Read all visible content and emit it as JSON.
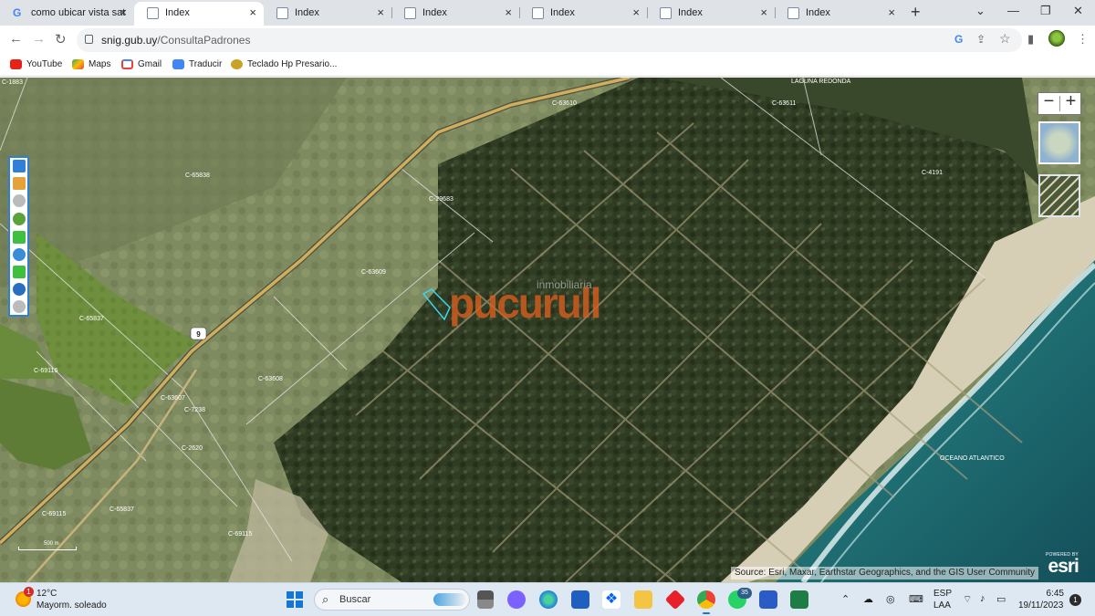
{
  "browser": {
    "tabs": [
      {
        "title": "como ubicar vista sat",
        "favicon": "google-icon",
        "active": false
      },
      {
        "title": "Index",
        "favicon": "page-icon",
        "active": true
      },
      {
        "title": "Index",
        "favicon": "page-icon",
        "active": false
      },
      {
        "title": "Index",
        "favicon": "page-icon",
        "active": false
      },
      {
        "title": "Index",
        "favicon": "page-icon",
        "active": false
      },
      {
        "title": "Index",
        "favicon": "page-icon",
        "active": false
      },
      {
        "title": "Index",
        "favicon": "page-icon",
        "active": false
      }
    ],
    "new_tab_symbol": "+",
    "url_host": "snig.gub.uy",
    "url_path": "/ConsultaPadrones",
    "bookmarks": [
      {
        "label": "YouTube",
        "icon": "youtube-icon",
        "color": "#e62117"
      },
      {
        "label": "Maps",
        "icon": "maps-icon",
        "color": "#34a853"
      },
      {
        "label": "Gmail",
        "icon": "gmail-icon",
        "color": "#ea4335"
      },
      {
        "label": "Traducir",
        "icon": "translate-icon",
        "color": "#4285f4"
      },
      {
        "label": "Teclado Hp Presario...",
        "icon": "keyboard-icon",
        "color": "#b8860b"
      }
    ]
  },
  "map": {
    "parcel_labels": [
      "C-1883",
      "C-63610",
      "C-63611",
      "LAGUNA REDONDA",
      "C-65838",
      "C-29683",
      "C-4191",
      "C-63609",
      "C-65837",
      "C-69116",
      "C-63608",
      "C-63607",
      "C-7238",
      "C-2620",
      "C-65837",
      "C-69115",
      "C-69115",
      "OCEANO ATLANTICO"
    ],
    "route_shield": "9",
    "watermark": "pucurull",
    "watermark_subtitle": "inmobiliaria",
    "scale_label": "500 m",
    "attribution": "Source: Esri, Maxar, Earthstar Geographics, and the GIS User Community",
    "esri_powered": "POWERED BY",
    "esri_brand": "esri",
    "zoom_out": "−",
    "zoom_in": "+",
    "colors": {
      "ocean": "#1f6f73",
      "forest": "#2f3b22",
      "road": "#c9a85a",
      "highlight": "#39d7f0",
      "watermark": "#d65e20"
    }
  },
  "taskbar": {
    "temperature": "12°C",
    "weather": "Mayorm. soleado",
    "weather_badge": "1",
    "search_label": "Buscar",
    "whatsapp_badge": "35",
    "language": "ESP",
    "language_sub": "LAA",
    "time": "6:45",
    "date": "19/11/2023",
    "notification_count": "1"
  }
}
